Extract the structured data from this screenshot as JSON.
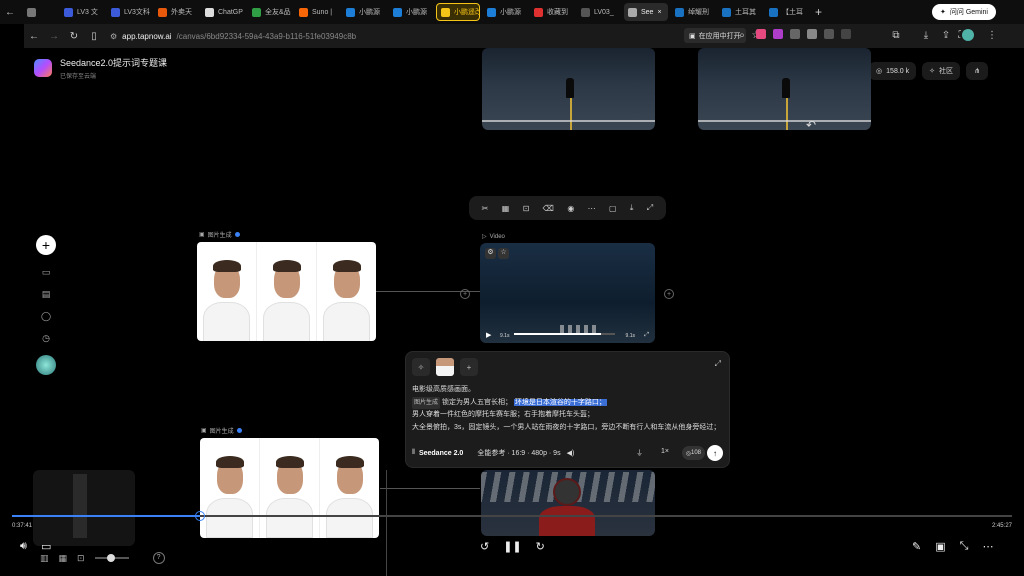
{
  "browser": {
    "tabs": [
      {
        "label": "",
        "color": "#777"
      },
      {
        "label": "LV3 文",
        "color": "#3b5bdb"
      },
      {
        "label": "LV3文科",
        "color": "#3b5bdb"
      },
      {
        "label": "外卖天",
        "color": "#e8590c"
      },
      {
        "label": "ChatGP",
        "color": "#ddd"
      },
      {
        "label": "全友&品",
        "color": "#2f9e44"
      },
      {
        "label": "Suno |",
        "color": "#f76707"
      },
      {
        "label": "小鹏源",
        "color": "#1c7ed6"
      },
      {
        "label": "小鹏源",
        "color": "#1c7ed6"
      },
      {
        "label": "小鹏遥改价",
        "color": "#f5c518",
        "style": "yellow"
      },
      {
        "label": "小鹏源",
        "color": "#1c7ed6"
      },
      {
        "label": "收藏到",
        "color": "#e03131"
      },
      {
        "label": "LV03_",
        "color": "#555"
      },
      {
        "label": "See",
        "color": "#aaa",
        "style": "active"
      },
      {
        "label": "绰耀刑",
        "color": "#1971c2"
      },
      {
        "label": "土耳其",
        "color": "#1971c2"
      },
      {
        "label": "【土耳",
        "color": "#1971c2"
      }
    ],
    "gemini_label": "问问 Gemini",
    "url_host": "app.tapnow.ai",
    "url_path": "/canvas/6bd92334-59a4-43a9-b116-51fe03949c8b",
    "open_in_app": "在应用中打开"
  },
  "app": {
    "title": "Seedance2.0提示词专题课",
    "subtitle": "已保存至云端",
    "credits": "158.0 k",
    "community": "社区"
  },
  "nodes": {
    "image_label_1": "图片生成",
    "image_label_2": "图片生成",
    "video_label": "Video",
    "video_time_left": "9.1s",
    "video_time_right": "9.1s"
  },
  "prompt": {
    "line1": "电影级高质感画面。",
    "tag": "图片生成",
    "line2_a": "锁定为男人五官长相；",
    "line2_hl": "环境是日本渲谷的十字路口；",
    "line3": "男人穿着一件红色的摩托车赛车服；右手抱着摩托车头盔；",
    "line4": "大全景俯拍，3s，固定镜头，一个男人站在雨夜的十字路口，旁边不断有行人和车流从他身旁经过；",
    "model": "Seedance 2.0",
    "params": "全能参考 · 16:9 · 480p · 9s",
    "count": "1×",
    "cost": "108"
  },
  "player": {
    "current_time": "0:37:41",
    "total_time": "2:45:27",
    "progress": 0.188
  }
}
